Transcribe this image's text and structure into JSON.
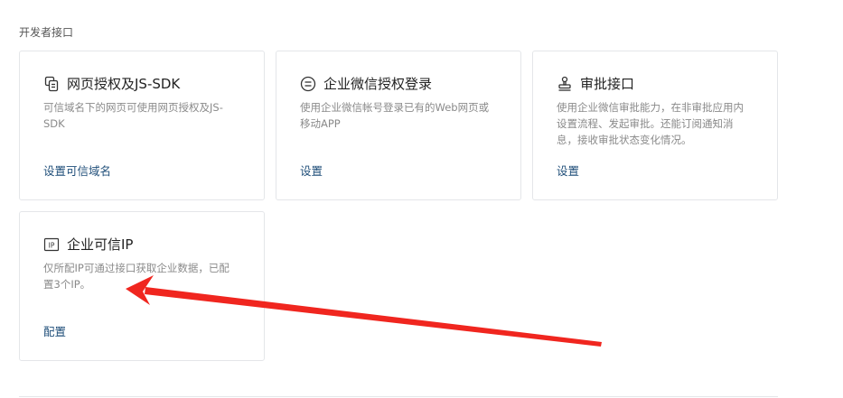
{
  "section": {
    "title": "开发者接口"
  },
  "cards": [
    {
      "title": "网页授权及JS-SDK",
      "desc_lines": [
        "可信域名下的网页可使用网页授权及JS-",
        "SDK"
      ],
      "link": "设置可信域名",
      "icon": "web-auth-icon"
    },
    {
      "title": "企业微信授权登录",
      "desc_lines": [
        "使用企业微信帐号登录已有的Web网页或",
        "移动APP"
      ],
      "link": "设置",
      "icon": "wechat-login-icon"
    },
    {
      "title": "审批接口",
      "desc_lines": [
        "使用企业微信审批能力，在非审批应用内",
        "设置流程、发起审批。还能订阅通知消",
        "息，接收审批状态变化情况。"
      ],
      "link": "设置",
      "icon": "stamp-icon"
    },
    {
      "title": "企业可信IP",
      "desc_lines": [
        "仅所配IP可通过接口获取企业数据，已配",
        "置3个IP。"
      ],
      "link": "配置",
      "icon": "ip-icon"
    }
  ],
  "colors": {
    "link": "#1f4e79",
    "annotation_arrow": "#f0261f"
  }
}
